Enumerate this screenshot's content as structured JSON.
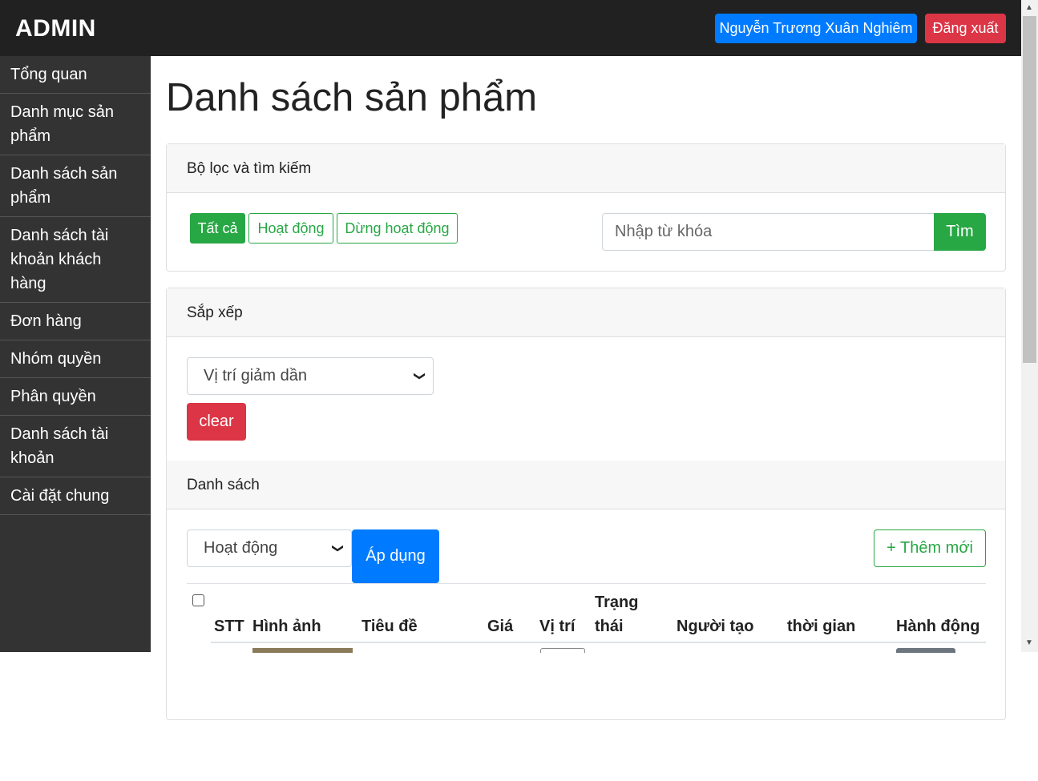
{
  "header": {
    "brand": "ADMIN",
    "user_button": "Nguyễn Trương Xuân Nghiêm",
    "logout_button": "Đăng xuất"
  },
  "sidebar": {
    "items": [
      {
        "label": "Tổng quan"
      },
      {
        "label": "Danh mục sản phẩm"
      },
      {
        "label": "Danh sách sản phẩm"
      },
      {
        "label": "Danh sách tài khoản khách hàng"
      },
      {
        "label": "Đơn hàng"
      },
      {
        "label": "Nhóm quyền"
      },
      {
        "label": "Phân quyền"
      },
      {
        "label": "Danh sách tài khoản"
      },
      {
        "label": "Cài đặt chung"
      }
    ]
  },
  "main": {
    "title": "Danh sách sản phẩm",
    "filter_card": {
      "header": "Bộ lọc và tìm kiếm",
      "buttons": [
        "Tất cả",
        "Hoạt động",
        "Dừng hoạt động"
      ],
      "search_placeholder": "Nhập từ khóa",
      "search_button": "Tìm"
    },
    "sort_card": {
      "header": "Sắp xếp",
      "selected": "Vị trí giảm dần",
      "clear_button": "clear"
    },
    "list_card": {
      "header": "Danh sách",
      "status_select": "Hoạt động",
      "apply_button": "Áp dụng",
      "add_button": "+ Thêm mới",
      "columns": [
        "STT",
        "Hình ảnh",
        "Tiêu đề",
        "Giá",
        "Vị trí",
        "Trạng thái",
        "Người tạo",
        "thời gian",
        "Hành động"
      ]
    }
  },
  "colors": {
    "primary": "#007bff",
    "danger": "#dc3545",
    "success": "#28a745",
    "dark": "#212121",
    "sidebar": "#333333"
  }
}
